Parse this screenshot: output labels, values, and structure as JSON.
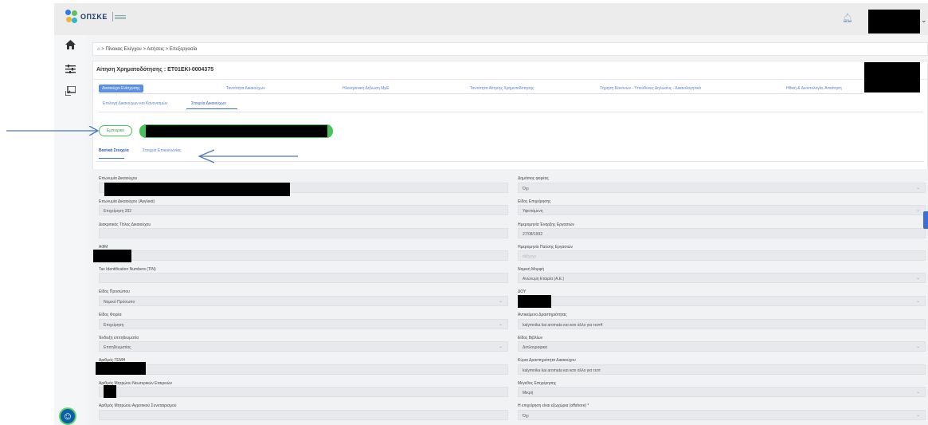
{
  "header": {
    "logo_text": "ΟΠΣΚΕ",
    "icons": [
      "bell-icon",
      "chevron-down-icon"
    ]
  },
  "sidebar": {
    "icons": [
      "home-icon",
      "sliders-icon",
      "export-icon",
      "accessibility-icon"
    ]
  },
  "breadcrumb": "⌂ > Πίνακας Ελέγχου > Αιτήσεις > Επεξεργασία",
  "card_title": "Αίτηση Χρηματοδότησης : ET01EKI-0004375",
  "steps": [
    "Δικαιούχοι Ενίσχυσης",
    "Ταυτότητα Δικαιούχων",
    "Ηλεκτρονική Δήλωση ΜμΕ",
    "Ταυτότητα Αίτησης Χρηματοδότησης",
    "Τήρηση Κανόνων - Υπεύθυνες Δηλώσεις - Δικαιολογητικά",
    "Ηθική & Δεοντολογία, Απαίτηση"
  ],
  "subtabs": [
    "Επιλογή Δικαιούχων και Κανονισμών",
    "Στοιχεία Δικαιούχων"
  ],
  "pill_label": "Εμπειρικό",
  "detail_tabs": [
    "Βασικά Στοιχεία",
    "Στοιχεία Επικοινωνίας"
  ],
  "left_fields": [
    {
      "label": "Επωνυμία Δικαιούχου",
      "value": ""
    },
    {
      "label": "Επωνυμία Δικαιούχου (Αγγλικά)",
      "value": "Επιχείρηση 202"
    },
    {
      "label": "Διακριτικός Τίτλος Δικαιούχου",
      "value": ""
    },
    {
      "label": "ΑΦΜ",
      "value": ""
    },
    {
      "label": "Tax Identification Numbers (TIN)",
      "value": ""
    },
    {
      "label": "Είδος Προσώπου",
      "value": "Νομικό Πρόσωπο"
    },
    {
      "label": "Είδος Φορέα",
      "value": "Επιχείρηση"
    },
    {
      "label": "Ένδειξη επιτηδευματία",
      "value": "Επιτηδευματίας"
    },
    {
      "label": "Αριθμός ΓΕΜΗ",
      "value": ""
    },
    {
      "label": "Αριθμός Μητρώου Νεωτερικών Εταιρειών",
      "value": ""
    },
    {
      "label": "Αριθμός Μητρώου Αγροτικού Συνεταιρισμού",
      "value": ""
    }
  ],
  "right_fields": [
    {
      "label": "Δημόσιος φορέας",
      "value": "Όχι"
    },
    {
      "label": "Είδος Επιχείρησης",
      "value": "Υφιστάμενη"
    },
    {
      "label": "Ημερομηνία Έναρξης Εργασιών",
      "value": "27/08/1992"
    },
    {
      "label": "Ημερομηνία Παύσης Εργασιών",
      "value": "dd/yyyy"
    },
    {
      "label": "Νομική Μορφή",
      "value": "Ανώνυμη Εταιρία (Α.Ε.)"
    },
    {
      "label": "ΔΟΥ",
      "value": ""
    },
    {
      "label": "Αντικείμενο Δραστηριότητας",
      "value": "kalymnika kai aromata και κατι άλλο για τεστ4"
    },
    {
      "label": "Είδος Βιβλίων",
      "value": "Διπλογραφικά"
    },
    {
      "label": "Κύρια Δραστηριότητα Δικαιούχου",
      "value": "kalymnika kai aromata και κατι άλλο για τεστ"
    },
    {
      "label": "Μέγεθος Επιχείρησης",
      "value": "Μικρή"
    },
    {
      "label": "Η επιχείρηση είναι εξωχώρια (offshore) *",
      "value": "Όχι"
    }
  ]
}
